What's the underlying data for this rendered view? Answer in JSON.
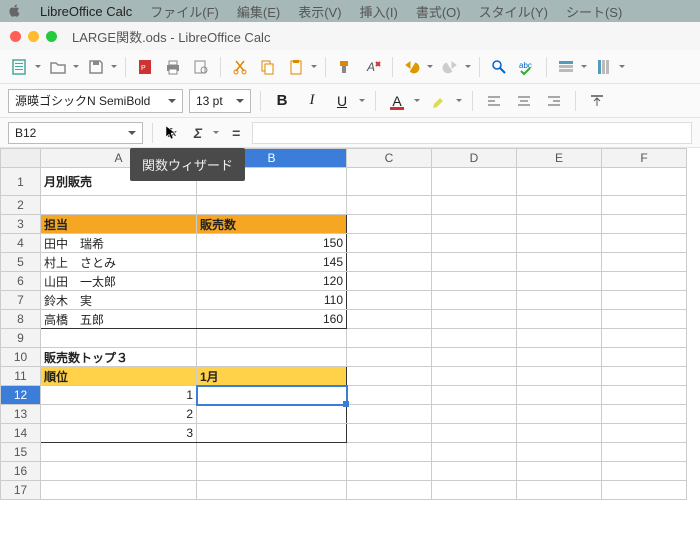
{
  "menubar": {
    "app": "LibreOffice Calc",
    "items": [
      "ファイル(F)",
      "編集(E)",
      "表示(V)",
      "挿入(I)",
      "書式(O)",
      "スタイル(Y)",
      "シート(S)"
    ]
  },
  "window": {
    "title": "LARGE関数.ods - LibreOffice Calc"
  },
  "format": {
    "font": "源暎ゴシックN SemiBold",
    "size": "13 pt"
  },
  "namebox": {
    "ref": "B12"
  },
  "tooltip": "関数ウィザード",
  "cols": [
    "A",
    "B",
    "C",
    "D",
    "E",
    "F"
  ],
  "rows": [
    "1",
    "2",
    "3",
    "4",
    "5",
    "6",
    "7",
    "8",
    "9",
    "10",
    "11",
    "12",
    "13",
    "14",
    "15",
    "16",
    "17"
  ],
  "sheet": {
    "title": "月別販売",
    "hdr_person": "担当",
    "hdr_sales": "販売数",
    "data": [
      {
        "name": "田中　瑞希",
        "val": "150"
      },
      {
        "name": "村上　さとみ",
        "val": "145"
      },
      {
        "name": "山田　一太郎",
        "val": "120"
      },
      {
        "name": "鈴木　実",
        "val": "110"
      },
      {
        "name": "高橋　五郎",
        "val": "160"
      }
    ],
    "top_title": "販売数トップ３",
    "rank_hdr": "順位",
    "month_hdr": "1月",
    "ranks": [
      "1",
      "2",
      "3"
    ]
  }
}
